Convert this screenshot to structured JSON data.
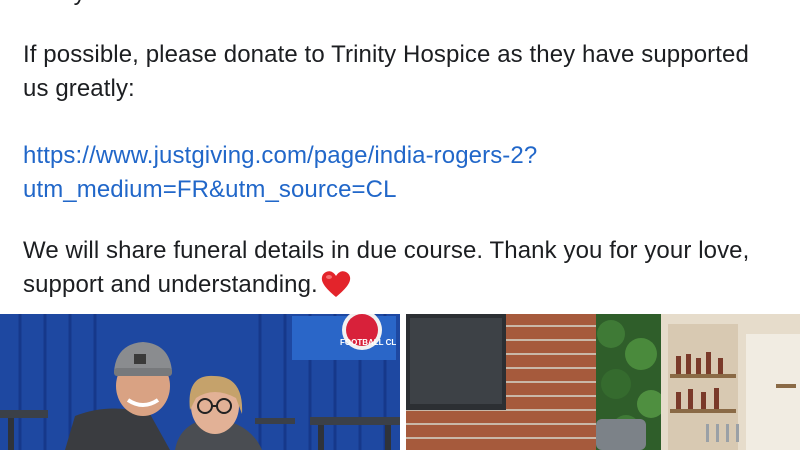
{
  "post": {
    "cut_text": "family.",
    "paragraph_1": "If possible, please donate to Trinity Hospice as they have supported us greatly:",
    "link_line_1": "https://www.justgiving.com/page/india-rogers-2?",
    "link_line_2": "utm_medium=FR&utm_source=CL",
    "paragraph_3": "We will share funeral details in due course. Thank you for your love, support and understanding."
  },
  "photos": {
    "left": {
      "sign_text": "FOOTBALL CL",
      "description_icon": "photo-two-people-smiling"
    },
    "right": {
      "description_icon": "photo-bar-interior"
    }
  },
  "colors": {
    "link": "#2167c9",
    "heart": "#e3242b",
    "text": "#1c1e21"
  }
}
